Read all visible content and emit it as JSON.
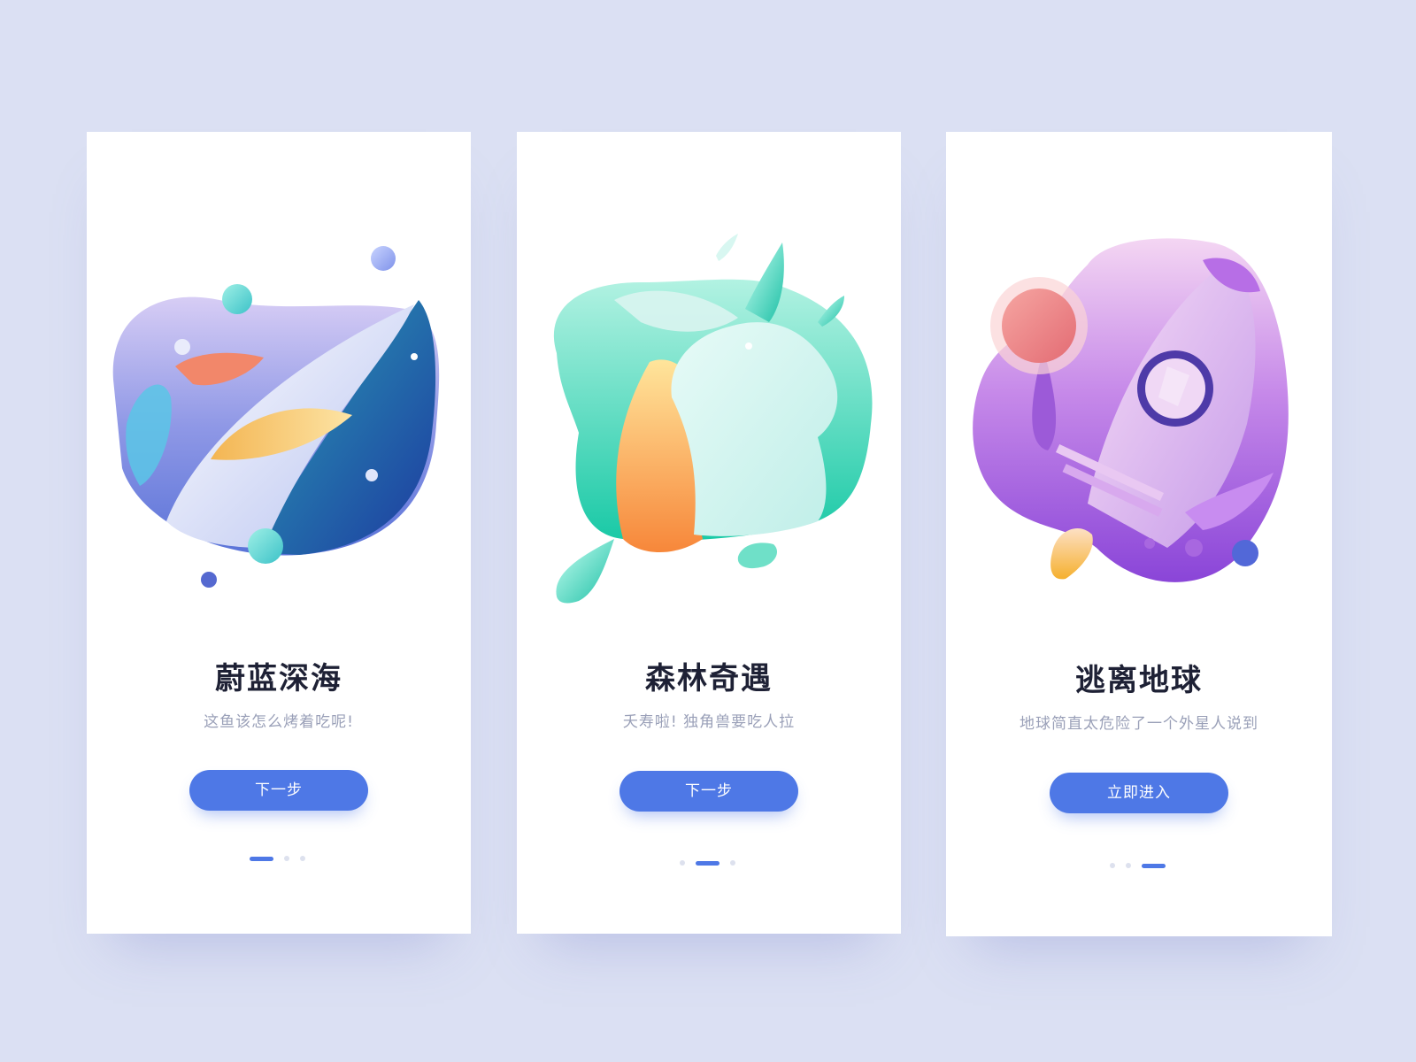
{
  "background": "#dbe0f3",
  "accent": "#4e78e6",
  "cards": [
    {
      "illustration": "whale-illustration",
      "title": "蔚蓝深海",
      "subtitle": "这鱼该怎么烤着吃呢!",
      "button": "下一步",
      "page_index": 1,
      "page_count": 3
    },
    {
      "illustration": "unicorn-illustration",
      "title": "森林奇遇",
      "subtitle": "夭寿啦! 独角兽要吃人拉",
      "button": "下一步",
      "page_index": 2,
      "page_count": 3
    },
    {
      "illustration": "rocket-illustration",
      "title": "逃离地球",
      "subtitle": "地球简直太危险了一个外星人说到",
      "button": "立即进入",
      "page_index": 3,
      "page_count": 3
    }
  ]
}
